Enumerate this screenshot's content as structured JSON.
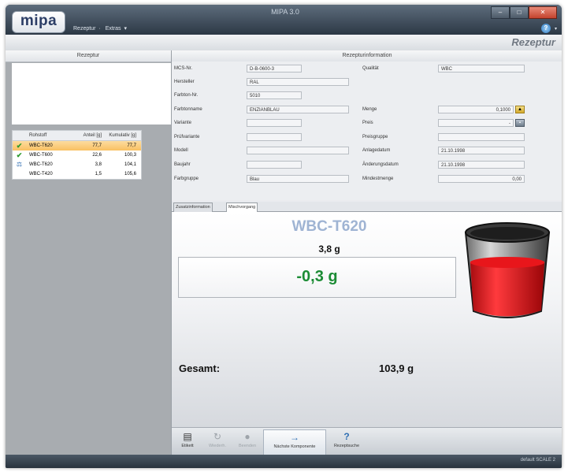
{
  "window": {
    "title": "MIPA 3.0",
    "logo": "mipa",
    "menu": [
      "Rezeptur",
      "Extras"
    ],
    "controls": {
      "minimize": "–",
      "maximize": "□",
      "close": "✕"
    }
  },
  "header": {
    "title": "Rezeptur",
    "help": "?"
  },
  "rezeptur_panel": {
    "title": "Rezeptur",
    "columns": [
      "Rohstoff",
      "Anteil [g]",
      "Kumulativ [g]"
    ],
    "rows": [
      {
        "status": "check",
        "rohstoff": "WBC-T620",
        "anteil": "77,7",
        "kumulativ": "77,7",
        "selected": true
      },
      {
        "status": "check",
        "rohstoff": "WBC-T600",
        "anteil": "22,6",
        "kumulativ": "100,3",
        "selected": false
      },
      {
        "status": "scale",
        "rohstoff": "WBC-T620",
        "anteil": "3,8",
        "kumulativ": "104,1",
        "selected": false
      },
      {
        "status": "",
        "rohstoff": "WBC-T420",
        "anteil": "1,5",
        "kumulativ": "105,6",
        "selected": false
      }
    ],
    "status_icons": {
      "check": "✔",
      "scale": "⚖"
    }
  },
  "info_panel": {
    "title": "Rezepturinformation",
    "left_fields": [
      {
        "label": "MCS-Nr.",
        "value": "D-B-0600-3"
      },
      {
        "label": "Hersteller",
        "value": "RAL"
      },
      {
        "label": "Farbton-Nr.",
        "value": "5010"
      },
      {
        "label": "Farbtonname",
        "value": "ENZIANBLAU"
      },
      {
        "label": "Variante",
        "value": ""
      },
      {
        "label": "Prüfvariante",
        "value": ""
      },
      {
        "label": "Modell",
        "value": ""
      },
      {
        "label": "Baujahr",
        "value": ""
      },
      {
        "label": "Farbgruppe",
        "value": "Blau"
      }
    ],
    "right_fields": [
      {
        "label": "Qualität",
        "value": "WBC"
      },
      {
        "label": "Menge",
        "value": "0,1000"
      },
      {
        "label": "Preis",
        "value": "-"
      },
      {
        "label": "Preisgruppe",
        "value": ""
      },
      {
        "label": "Anlagedatum",
        "value": "21.10.1998"
      },
      {
        "label": "Änderungsdatum",
        "value": "21.10.1998"
      },
      {
        "label": "Mindestmenge",
        "value": "0,00"
      }
    ]
  },
  "tabs": [
    {
      "label": "Zusatzinformation",
      "active": false
    },
    {
      "label": "Mischvorgang",
      "active": true
    }
  ],
  "scale": {
    "component": "WBC-T620",
    "target": "3,8 g",
    "difference": "-0,3 g",
    "total_label": "Gesamt:",
    "total_value": "103,9 g",
    "fill_level": 0.62,
    "liquid_color": "#e8161b",
    "difference_color": "#1c8c35"
  },
  "toolbar": [
    {
      "label": "Etikett",
      "icon": "label-icon",
      "glyph": "▤",
      "enabled": true
    },
    {
      "label": "Wiederh.",
      "icon": "repeat-icon",
      "glyph": "↻",
      "enabled": false
    },
    {
      "label": "Beenden",
      "icon": "stop-icon",
      "glyph": "●",
      "enabled": false
    },
    {
      "label": "Nächste Komponente",
      "icon": "arrow-right-icon",
      "glyph": "→",
      "enabled": true
    },
    {
      "label": "Rezeptsuche",
      "icon": "help-icon",
      "glyph": "?",
      "enabled": true
    }
  ],
  "status": "default  SCALE 2"
}
